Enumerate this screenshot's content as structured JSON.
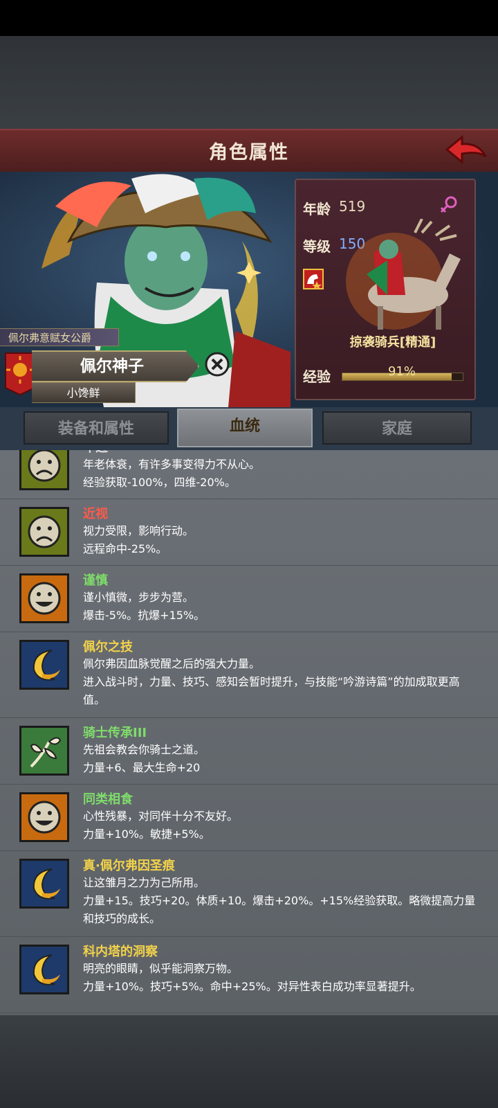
{
  "header": {
    "title": "角色属性"
  },
  "hero": {
    "title_ribbon": "佩尔弗意赋女公爵",
    "name": "佩尔神子",
    "nickname": "小馋鲜"
  },
  "stats": {
    "age_label": "年龄",
    "age_value": "519",
    "level_label": "等级",
    "level_value": "150",
    "unit_name": "掠袭骑兵[精通]",
    "xp_label": "经验",
    "xp_percent": "91%",
    "xp_fraction": 0.91,
    "gender_icon": "female-icon",
    "colors": {
      "level_value": "#7fb0ff",
      "gender": "#e060c0",
      "unit_name": "#f4e2a0"
    }
  },
  "tabs": [
    {
      "label": "装备和属性",
      "active": false
    },
    {
      "label": "血统",
      "active": true
    },
    {
      "label": "家庭",
      "active": false
    }
  ],
  "traits": [
    {
      "name": "年迈",
      "name_color": "#e0e0e0",
      "icon": "sad-face-icon",
      "icon_bg": "#6a7a1a",
      "desc": "年老体衰，有许多事变得力不从心。",
      "effect": "经验获取-100%，四维-20%。"
    },
    {
      "name": "近视",
      "name_color": "#ff5a4a",
      "icon": "sad-face-icon",
      "icon_bg": "#6a7a1a",
      "desc": "视力受限，影响行动。",
      "effect": "远程命中-25%。"
    },
    {
      "name": "谨慎",
      "name_color": "#7fdc6a",
      "icon": "happy-face-icon",
      "icon_bg": "#c86a10",
      "desc": "谨小慎微，步步为营。",
      "effect": "爆击-5%。抗爆+15%。"
    },
    {
      "name": "佩尔之技",
      "name_color": "#f2d24a",
      "icon": "crescent-moon-icon",
      "icon_bg": "#1e3a6a",
      "desc": "佩尔弗因血脉觉醒之后的强大力量。",
      "effect": "进入战斗时，力量、技巧、感知会暂时提升，与技能“吟游诗篇”的加成取更高值。"
    },
    {
      "name": "骑士传承III",
      "name_color": "#7fdc6a",
      "icon": "leaf-branch-icon",
      "icon_bg": "#3a7a3a",
      "desc": "先祖会教会你骑士之道。",
      "effect": "力量+6、最大生命+20"
    },
    {
      "name": "同类相食",
      "name_color": "#7fdc6a",
      "icon": "happy-face-icon",
      "icon_bg": "#c86a10",
      "desc": "心性残暴，对同伴十分不友好。",
      "effect": "力量+10%。敏捷+5%。"
    },
    {
      "name": "真·佩尔弗因圣痕",
      "name_color": "#f2d24a",
      "icon": "crescent-moon-icon",
      "icon_bg": "#1e3a6a",
      "desc": "让这雏月之力为己所用。",
      "effect": "力量+15。技巧+20。体质+10。爆击+20%。+15%经验获取。略微提高力量和技巧的成长。"
    },
    {
      "name": "科内塔的洞察",
      "name_color": "#f2d24a",
      "icon": "crescent-moon-icon",
      "icon_bg": "#1e3a6a",
      "desc": "明亮的眼睛，似乎能洞察万物。",
      "effect": "力量+10%。技巧+5%。命中+25%。对异性表白成功率显著提升。"
    }
  ]
}
